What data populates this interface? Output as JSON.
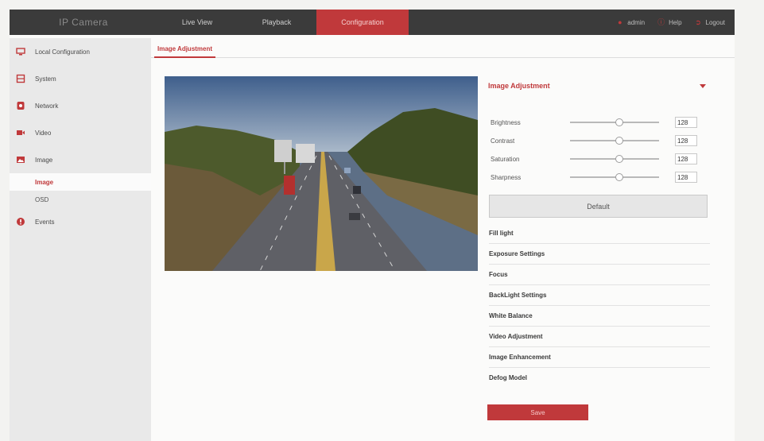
{
  "header": {
    "brand": "IP Camera",
    "nav": [
      {
        "label": "Live View"
      },
      {
        "label": "Playback"
      },
      {
        "label": "Configuration",
        "active": true
      }
    ],
    "right": [
      {
        "label": "admin",
        "icon": "user-icon"
      },
      {
        "label": "Help",
        "icon": "help-icon"
      },
      {
        "label": "Logout",
        "icon": "logout-icon"
      }
    ]
  },
  "sidebar": {
    "items": [
      {
        "label": "Local Configuration",
        "icon": "monitor-icon"
      },
      {
        "label": "System",
        "icon": "system-icon"
      },
      {
        "label": "Network",
        "icon": "network-icon"
      },
      {
        "label": "Video",
        "icon": "video-icon"
      },
      {
        "label": "Image",
        "icon": "image-icon"
      },
      {
        "label": "Events",
        "icon": "events-icon"
      }
    ],
    "sub": [
      {
        "label": "Image",
        "active": true
      },
      {
        "label": "OSD"
      }
    ]
  },
  "tab": {
    "label": "Image Adjustment"
  },
  "panel": {
    "title": "Image Adjustment",
    "sliders": [
      {
        "label": "Brightness",
        "value": "128",
        "level": 0.55
      },
      {
        "label": "Contrast",
        "value": "128",
        "level": 0.55
      },
      {
        "label": "Saturation",
        "value": "128",
        "level": 0.55
      },
      {
        "label": "Sharpness",
        "value": "128",
        "level": 0.55
      }
    ],
    "default_label": "Default",
    "sections": [
      {
        "label": "Fill light"
      },
      {
        "label": "Exposure Settings"
      },
      {
        "label": "Focus"
      },
      {
        "label": "BackLight Settings"
      },
      {
        "label": "White Balance"
      },
      {
        "label": "Video Adjustment"
      },
      {
        "label": "Image Enhancement"
      },
      {
        "label": "Defog Model"
      }
    ],
    "save_label": "Save"
  },
  "colors": {
    "accent": "#c0393b",
    "topbar": "#3b3b3b",
    "sidebar": "#e9e9e9"
  }
}
